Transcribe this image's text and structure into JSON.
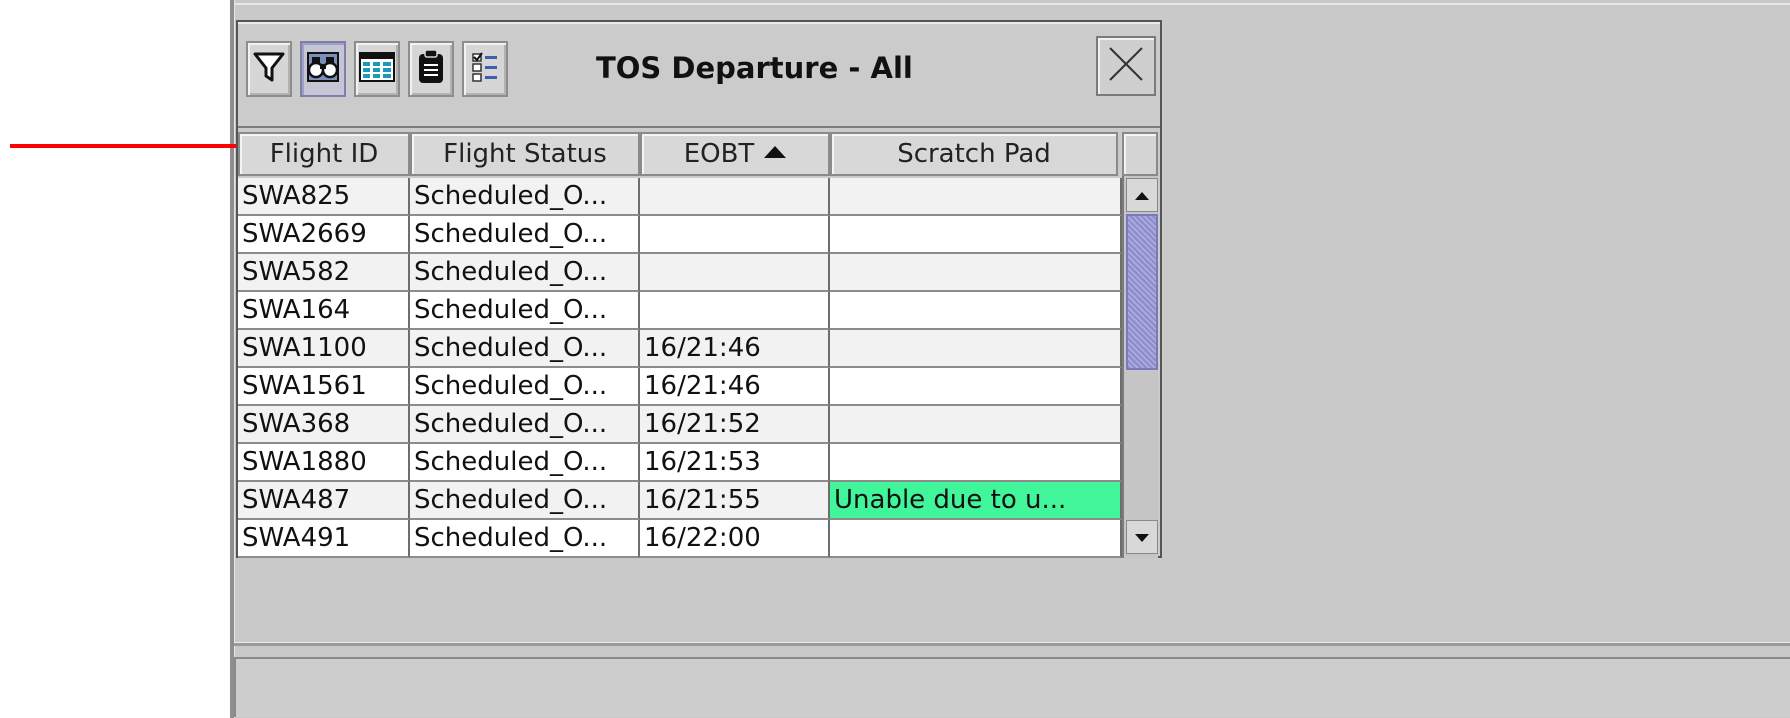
{
  "panel": {
    "title": "TOS Departure - All",
    "toolbar": {
      "icons": [
        "filter-icon",
        "binoculars-icon",
        "table-icon",
        "clipboard-icon",
        "checklist-icon"
      ]
    }
  },
  "table": {
    "columns": [
      "Flight ID",
      "Flight Status",
      "EOBT",
      "Scratch Pad"
    ],
    "sort_column": "EOBT",
    "sort_direction": "ascending",
    "rows": [
      {
        "flight_id": "SWA825",
        "status": "Scheduled_O...",
        "eobt": "",
        "scratch": ""
      },
      {
        "flight_id": "SWA2669",
        "status": "Scheduled_O...",
        "eobt": "",
        "scratch": ""
      },
      {
        "flight_id": "SWA582",
        "status": "Scheduled_O...",
        "eobt": "",
        "scratch": ""
      },
      {
        "flight_id": "SWA164",
        "status": "Scheduled_O...",
        "eobt": "",
        "scratch": ""
      },
      {
        "flight_id": "SWA1100",
        "status": "Scheduled_O...",
        "eobt": "16/21:46",
        "scratch": ""
      },
      {
        "flight_id": "SWA1561",
        "status": "Scheduled_O...",
        "eobt": "16/21:46",
        "scratch": ""
      },
      {
        "flight_id": "SWA368",
        "status": "Scheduled_O...",
        "eobt": "16/21:52",
        "scratch": ""
      },
      {
        "flight_id": "SWA1880",
        "status": "Scheduled_O...",
        "eobt": "16/21:53",
        "scratch": ""
      },
      {
        "flight_id": "SWA487",
        "status": "Scheduled_O...",
        "eobt": "16/21:55",
        "scratch": "Unable due to u..."
      },
      {
        "flight_id": "SWA491",
        "status": "Scheduled_O...",
        "eobt": "16/22:00",
        "scratch": ""
      }
    ],
    "highlight_color": "#40f59a"
  },
  "annotation": {
    "arrow_color": "#ff0000"
  }
}
